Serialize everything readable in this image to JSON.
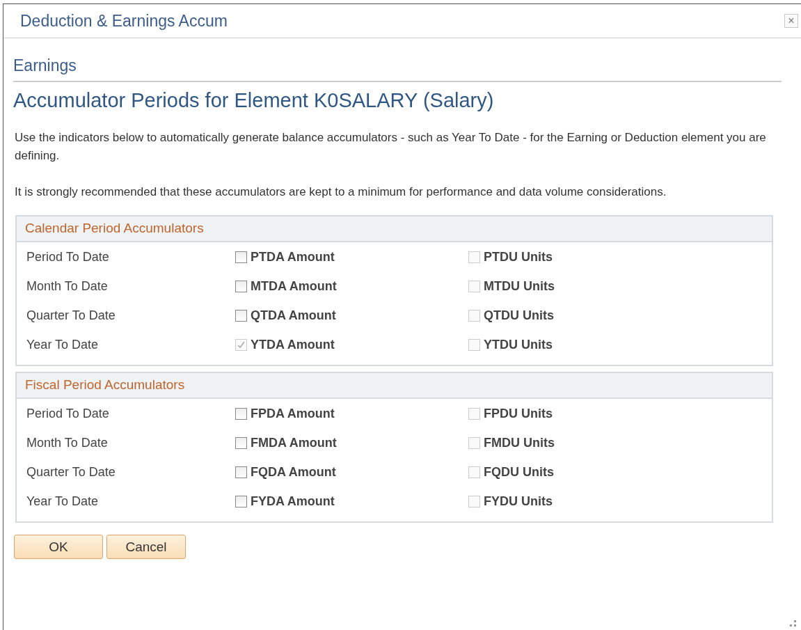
{
  "window": {
    "title": "Deduction & Earnings Accum",
    "close": "×"
  },
  "section": "Earnings",
  "heading": "Accumulator Periods for Element K0SALARY (Salary)",
  "paragraphs": [
    "Use the indicators below to automatically generate balance accumulators - such as Year To Date - for the Earning or Deduction element you are defining.",
    "It is strongly recommended that these accumulators are kept to a minimum for performance and data volume considerations."
  ],
  "groups": [
    {
      "title": "Calendar Period Accumulators",
      "rows": [
        {
          "label": "Period To Date",
          "amount": {
            "label": "PTDA Amount",
            "checked": false,
            "disabled": false
          },
          "units": {
            "label": "PTDU Units",
            "checked": false,
            "disabled": true
          }
        },
        {
          "label": "Month To Date",
          "amount": {
            "label": "MTDA Amount",
            "checked": false,
            "disabled": false
          },
          "units": {
            "label": "MTDU Units",
            "checked": false,
            "disabled": true
          }
        },
        {
          "label": "Quarter To Date",
          "amount": {
            "label": "QTDA Amount",
            "checked": false,
            "disabled": false
          },
          "units": {
            "label": "QTDU Units",
            "checked": false,
            "disabled": true
          }
        },
        {
          "label": "Year To Date",
          "amount": {
            "label": "YTDA Amount",
            "checked": true,
            "disabled": true
          },
          "units": {
            "label": "YTDU Units",
            "checked": false,
            "disabled": true
          }
        }
      ]
    },
    {
      "title": "Fiscal Period Accumulators",
      "rows": [
        {
          "label": "Period To Date",
          "amount": {
            "label": "FPDA Amount",
            "checked": false,
            "disabled": false
          },
          "units": {
            "label": "FPDU Units",
            "checked": false,
            "disabled": true
          }
        },
        {
          "label": "Month To Date",
          "amount": {
            "label": "FMDA Amount",
            "checked": false,
            "disabled": false
          },
          "units": {
            "label": "FMDU Units",
            "checked": false,
            "disabled": true
          }
        },
        {
          "label": "Quarter To Date",
          "amount": {
            "label": "FQDA Amount",
            "checked": false,
            "disabled": false
          },
          "units": {
            "label": "FQDU Units",
            "checked": false,
            "disabled": true
          }
        },
        {
          "label": "Year To Date",
          "amount": {
            "label": "FYDA Amount",
            "checked": false,
            "disabled": false
          },
          "units": {
            "label": "FYDU Units",
            "checked": false,
            "disabled": true
          }
        }
      ]
    }
  ],
  "buttons": [
    "OK",
    "Cancel"
  ]
}
